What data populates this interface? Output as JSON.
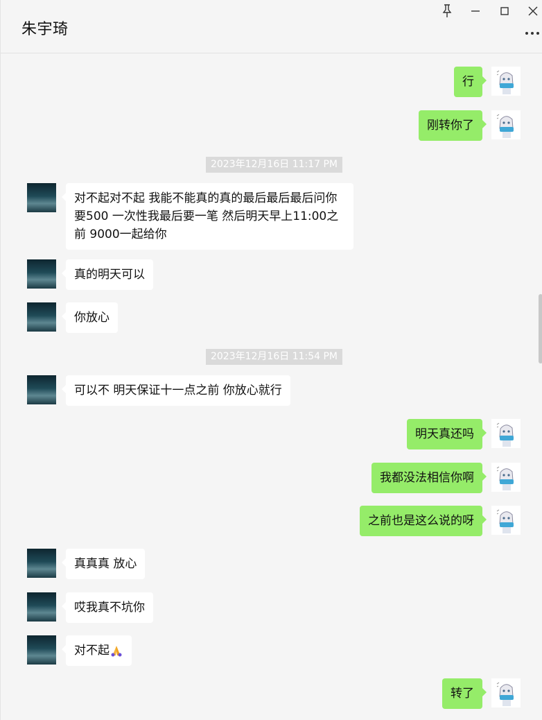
{
  "window": {
    "title": "朱宇琦",
    "controls": [
      "pin-icon",
      "minimize-icon",
      "maximize-icon",
      "close-icon"
    ],
    "more_icon": "more-dots-icon"
  },
  "colors": {
    "my_bubble": "#95ec69",
    "their_bubble": "#ffffff",
    "background": "#f5f5f5",
    "timestamp_bg": "#dadada"
  },
  "messages": [
    {
      "type": "me",
      "text": "行"
    },
    {
      "type": "me",
      "text": "刚转你了"
    },
    {
      "type": "time",
      "text": "2023年12月16日 11:17 PM"
    },
    {
      "type": "them",
      "text": "对不起对不起 我能不能真的真的最后最后最后问你要500 一次性我最后要一笔 然后明天早上11:00之前 9000一起给你"
    },
    {
      "type": "them",
      "text": "真的明天可以"
    },
    {
      "type": "them",
      "text": "你放心"
    },
    {
      "type": "time",
      "text": "2023年12月16日 11:54 PM"
    },
    {
      "type": "them",
      "text": "可以不 明天保证十一点之前 你放心就行"
    },
    {
      "type": "me",
      "text": "明天真还吗"
    },
    {
      "type": "me",
      "text": "我都没法相信你啊"
    },
    {
      "type": "me",
      "text": "之前也是这么说的呀"
    },
    {
      "type": "them",
      "text": "真真真 放心"
    },
    {
      "type": "them",
      "text": "哎我真不坑你"
    },
    {
      "type": "them",
      "text": "对不起",
      "emoji": "praying-hands-icon"
    },
    {
      "type": "me",
      "text": "转了"
    }
  ]
}
